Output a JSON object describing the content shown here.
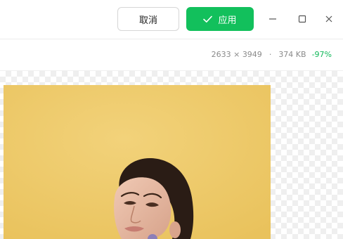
{
  "toolbar": {
    "cancel_label": "取消",
    "apply_label": "应用"
  },
  "image_info": {
    "dimensions": "2633 × 3949",
    "separator": "·",
    "file_size": "374 KB",
    "reduction": "-97%"
  },
  "colors": {
    "apply_green": "#12c05c",
    "reduction_green": "#12b85a",
    "photo_background": "#efc966"
  },
  "icons": {
    "apply": "check-icon",
    "minimize": "minimize-icon",
    "maximize": "maximize-icon",
    "close": "close-icon"
  }
}
